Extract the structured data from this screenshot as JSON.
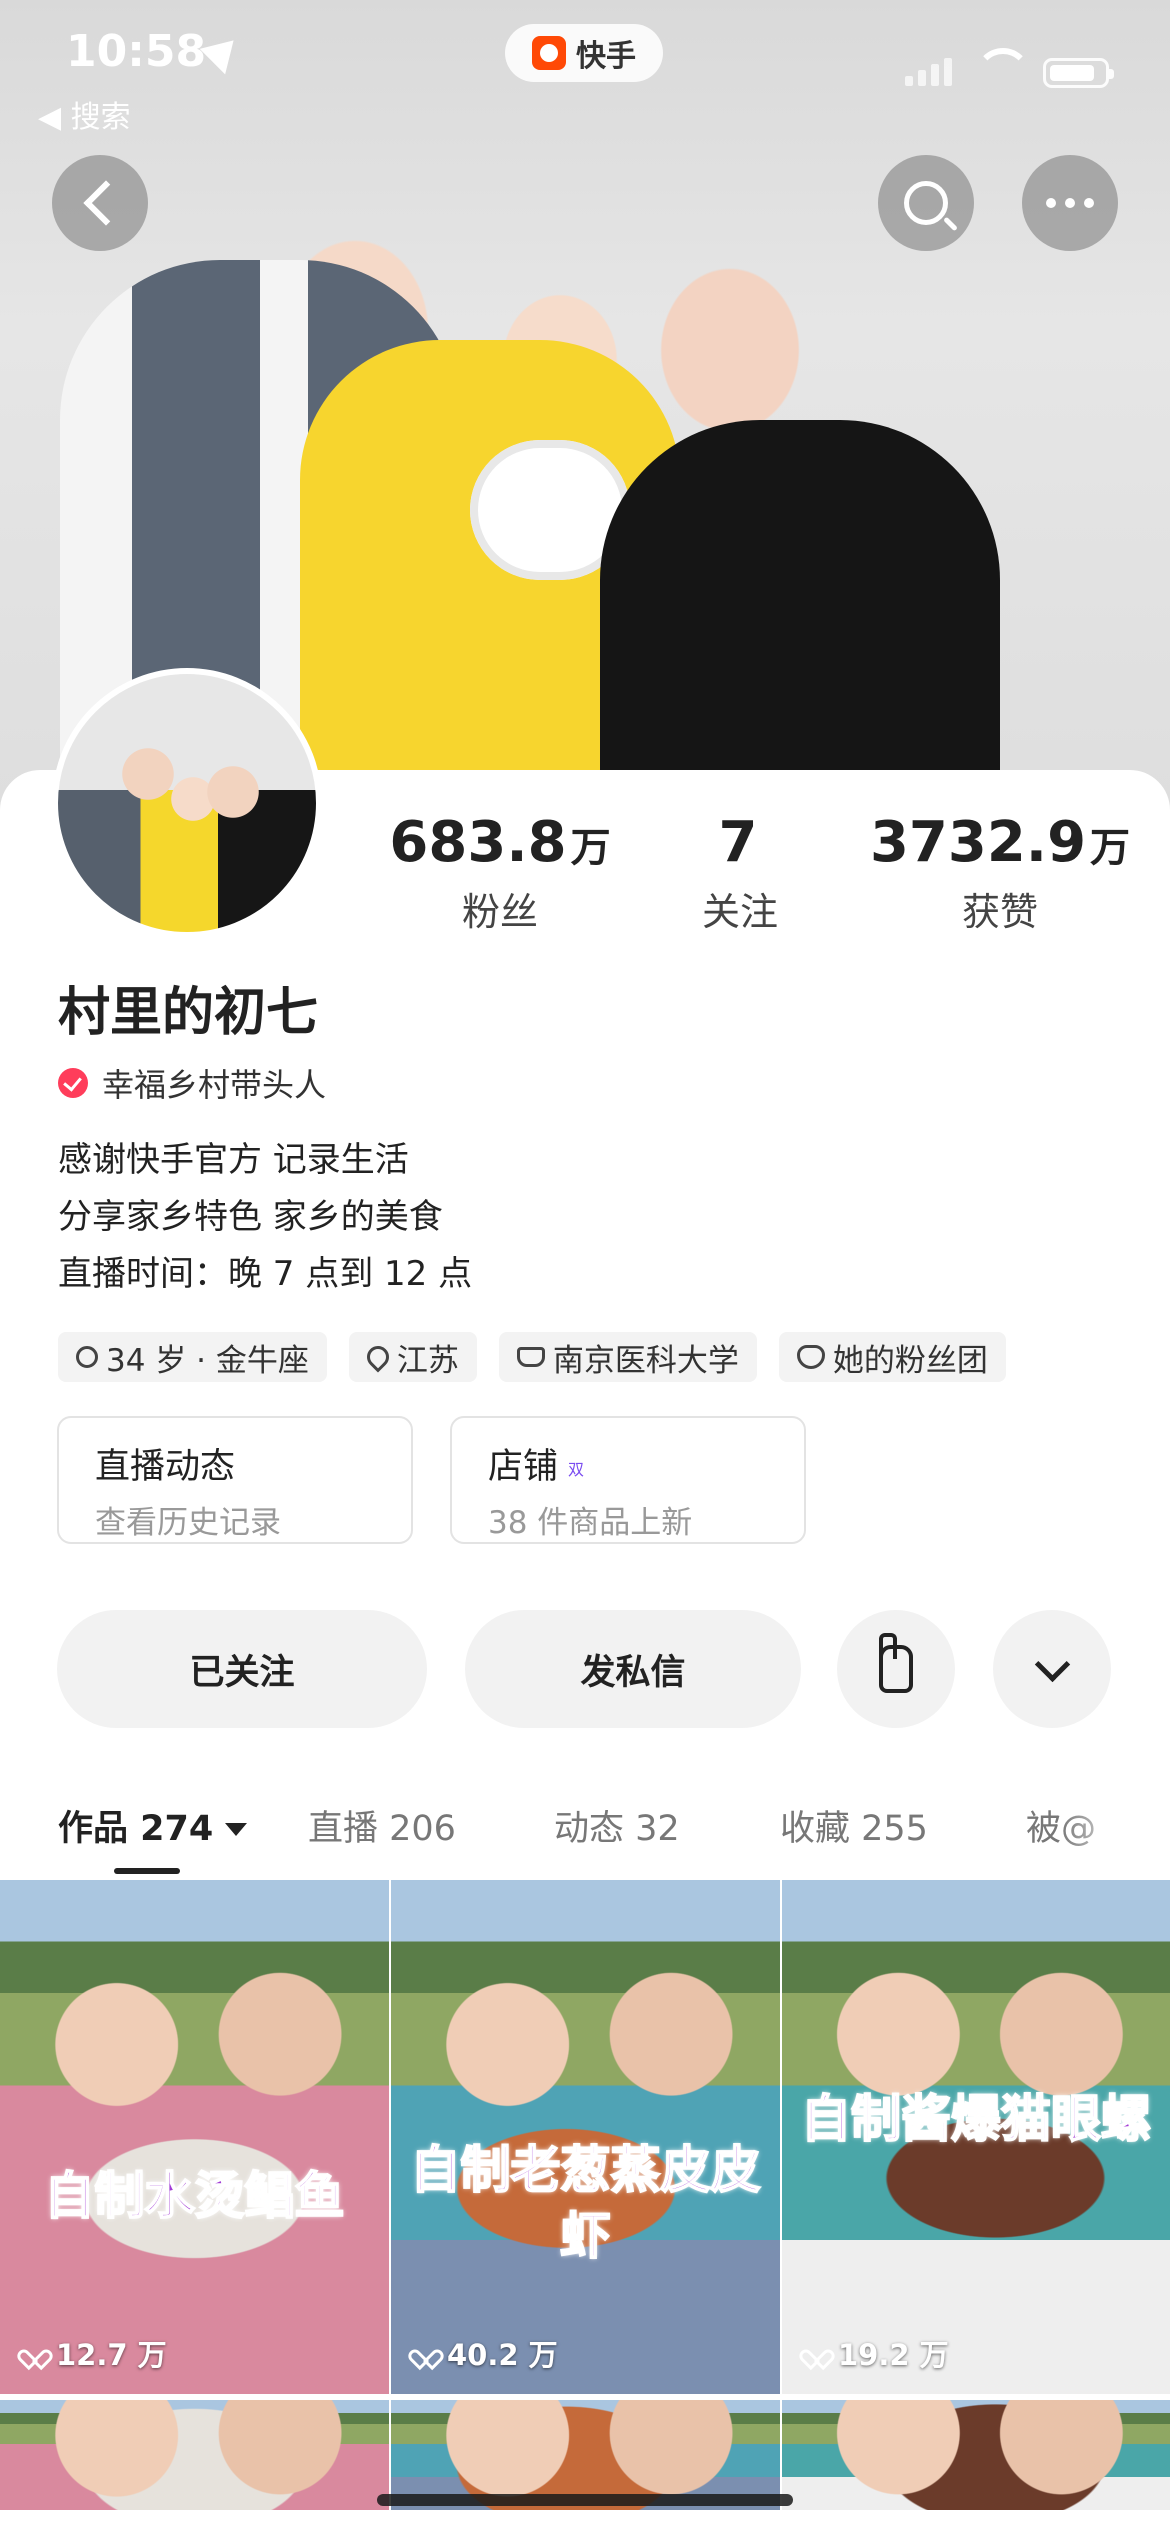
{
  "status": {
    "time": "10:58",
    "back_app": "◀ 搜索",
    "app_name": "快手"
  },
  "profile": {
    "stats": [
      {
        "value": "683.8",
        "unit": "万",
        "label": "粉丝"
      },
      {
        "value": "7",
        "unit": "",
        "label": "关注"
      },
      {
        "value": "3732.9",
        "unit": "万",
        "label": "获赞"
      }
    ],
    "name": "村里的初七",
    "verified_title": "幸福乡村带头人",
    "bio": [
      "感谢快手官方  记录生活",
      "分享家乡特色 家乡的美食",
      "直播时间：晚 7 点到 12 点"
    ],
    "tags": [
      {
        "icon": "gender-icon",
        "text": "34 岁 · 金牛座"
      },
      {
        "icon": "location-icon",
        "text": "江苏"
      },
      {
        "icon": "school-icon",
        "text": "南京医科大学"
      },
      {
        "icon": "fan-group-icon",
        "text": "她的粉丝团"
      }
    ],
    "features": {
      "live": {
        "title": "直播动态",
        "subtitle": "查看历史记录"
      },
      "shop": {
        "title": "店铺",
        "subtitle": "38 件商品上新",
        "mark": "双"
      }
    },
    "actions": {
      "followed": "已关注",
      "message": "发私信"
    }
  },
  "tabs": [
    {
      "label": "作品 274",
      "active": true
    },
    {
      "label": "直播 206"
    },
    {
      "label": "动态 32"
    },
    {
      "label": "收藏 255"
    },
    {
      "label": "被@"
    }
  ],
  "videos": [
    {
      "caption": "自制水烫鲳鱼",
      "likes": "12.7 万"
    },
    {
      "caption": "自制老葱蒸皮皮虾",
      "likes": "40.2 万"
    },
    {
      "caption": "自制酱爆猫眼螺",
      "likes": "19.2 万"
    }
  ],
  "colors": {
    "brand": "#ff4906",
    "verified": "#ff3d5b",
    "caption": "#a23bd6"
  }
}
